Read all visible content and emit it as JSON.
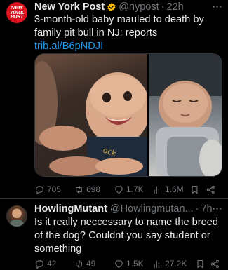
{
  "tweet1": {
    "avatar_icon": "new-york-post-logo",
    "avatar_lines": [
      "NEW",
      "YORK",
      "POST"
    ],
    "name": "New York Post",
    "verified_icon": "verified-badge-icon",
    "verified_color": "#f4b400",
    "handle": "@nypost",
    "separator": "·",
    "time": "22h",
    "more": "···",
    "text": "3-month-old baby mauled to death by family pit bull in NJ: reports ",
    "link": "trib.al/B6pNDJI",
    "media": [
      "smiling-baby-photo",
      "sleeping-baby-photo"
    ],
    "actions": {
      "reply": "705",
      "retweet": "698",
      "like": "1.7K",
      "views": "1.6M"
    }
  },
  "tweet2": {
    "avatar_icon": "user-avatar",
    "name": "HowlingMutant",
    "handle": "@Howlingmutan...",
    "separator": "·",
    "time": "7h",
    "more": "···",
    "text": "Is it really neccessary to name the breed of the dog? Couldnt you say student or something",
    "actions": {
      "reply": "42",
      "retweet": "49",
      "like": "1.5K",
      "views": "27.2K"
    }
  },
  "colors": {
    "background": "#000000",
    "text": "#e7e9ea",
    "muted": "#71767b",
    "link": "#1d9bf0",
    "brand_red": "#d9121e"
  }
}
